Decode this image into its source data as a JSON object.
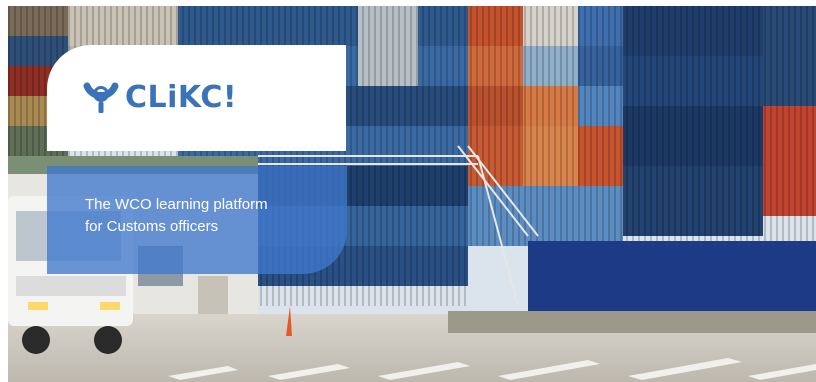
{
  "logo": {
    "icon": "wco-emblem-icon",
    "text": "CLiKC!",
    "color": "#3a73b7"
  },
  "tagline": {
    "line1": "The WCO learning platform",
    "line2": "for Customs officers"
  },
  "colors": {
    "panel_blue": "#4078cd",
    "logo_blue": "#3a73b7"
  }
}
